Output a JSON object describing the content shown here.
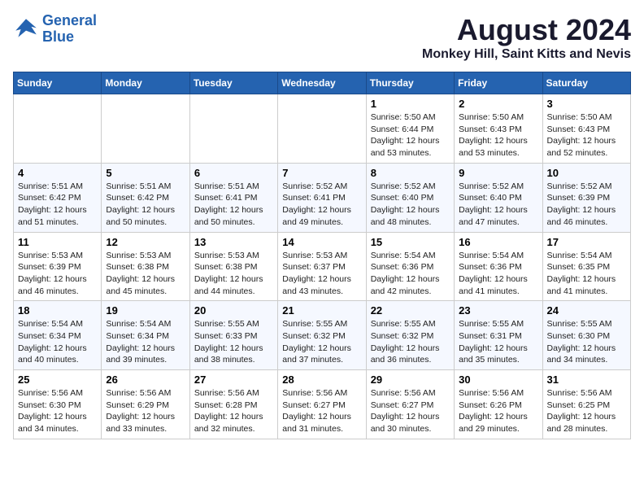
{
  "logo": {
    "line1": "General",
    "line2": "Blue"
  },
  "title": "August 2024",
  "subtitle": "Monkey Hill, Saint Kitts and Nevis",
  "days_header": [
    "Sunday",
    "Monday",
    "Tuesday",
    "Wednesday",
    "Thursday",
    "Friday",
    "Saturday"
  ],
  "weeks": [
    [
      {
        "num": "",
        "info": ""
      },
      {
        "num": "",
        "info": ""
      },
      {
        "num": "",
        "info": ""
      },
      {
        "num": "",
        "info": ""
      },
      {
        "num": "1",
        "info": "Sunrise: 5:50 AM\nSunset: 6:44 PM\nDaylight: 12 hours\nand 53 minutes."
      },
      {
        "num": "2",
        "info": "Sunrise: 5:50 AM\nSunset: 6:43 PM\nDaylight: 12 hours\nand 53 minutes."
      },
      {
        "num": "3",
        "info": "Sunrise: 5:50 AM\nSunset: 6:43 PM\nDaylight: 12 hours\nand 52 minutes."
      }
    ],
    [
      {
        "num": "4",
        "info": "Sunrise: 5:51 AM\nSunset: 6:42 PM\nDaylight: 12 hours\nand 51 minutes."
      },
      {
        "num": "5",
        "info": "Sunrise: 5:51 AM\nSunset: 6:42 PM\nDaylight: 12 hours\nand 50 minutes."
      },
      {
        "num": "6",
        "info": "Sunrise: 5:51 AM\nSunset: 6:41 PM\nDaylight: 12 hours\nand 50 minutes."
      },
      {
        "num": "7",
        "info": "Sunrise: 5:52 AM\nSunset: 6:41 PM\nDaylight: 12 hours\nand 49 minutes."
      },
      {
        "num": "8",
        "info": "Sunrise: 5:52 AM\nSunset: 6:40 PM\nDaylight: 12 hours\nand 48 minutes."
      },
      {
        "num": "9",
        "info": "Sunrise: 5:52 AM\nSunset: 6:40 PM\nDaylight: 12 hours\nand 47 minutes."
      },
      {
        "num": "10",
        "info": "Sunrise: 5:52 AM\nSunset: 6:39 PM\nDaylight: 12 hours\nand 46 minutes."
      }
    ],
    [
      {
        "num": "11",
        "info": "Sunrise: 5:53 AM\nSunset: 6:39 PM\nDaylight: 12 hours\nand 46 minutes."
      },
      {
        "num": "12",
        "info": "Sunrise: 5:53 AM\nSunset: 6:38 PM\nDaylight: 12 hours\nand 45 minutes."
      },
      {
        "num": "13",
        "info": "Sunrise: 5:53 AM\nSunset: 6:38 PM\nDaylight: 12 hours\nand 44 minutes."
      },
      {
        "num": "14",
        "info": "Sunrise: 5:53 AM\nSunset: 6:37 PM\nDaylight: 12 hours\nand 43 minutes."
      },
      {
        "num": "15",
        "info": "Sunrise: 5:54 AM\nSunset: 6:36 PM\nDaylight: 12 hours\nand 42 minutes."
      },
      {
        "num": "16",
        "info": "Sunrise: 5:54 AM\nSunset: 6:36 PM\nDaylight: 12 hours\nand 41 minutes."
      },
      {
        "num": "17",
        "info": "Sunrise: 5:54 AM\nSunset: 6:35 PM\nDaylight: 12 hours\nand 41 minutes."
      }
    ],
    [
      {
        "num": "18",
        "info": "Sunrise: 5:54 AM\nSunset: 6:34 PM\nDaylight: 12 hours\nand 40 minutes."
      },
      {
        "num": "19",
        "info": "Sunrise: 5:54 AM\nSunset: 6:34 PM\nDaylight: 12 hours\nand 39 minutes."
      },
      {
        "num": "20",
        "info": "Sunrise: 5:55 AM\nSunset: 6:33 PM\nDaylight: 12 hours\nand 38 minutes."
      },
      {
        "num": "21",
        "info": "Sunrise: 5:55 AM\nSunset: 6:32 PM\nDaylight: 12 hours\nand 37 minutes."
      },
      {
        "num": "22",
        "info": "Sunrise: 5:55 AM\nSunset: 6:32 PM\nDaylight: 12 hours\nand 36 minutes."
      },
      {
        "num": "23",
        "info": "Sunrise: 5:55 AM\nSunset: 6:31 PM\nDaylight: 12 hours\nand 35 minutes."
      },
      {
        "num": "24",
        "info": "Sunrise: 5:55 AM\nSunset: 6:30 PM\nDaylight: 12 hours\nand 34 minutes."
      }
    ],
    [
      {
        "num": "25",
        "info": "Sunrise: 5:56 AM\nSunset: 6:30 PM\nDaylight: 12 hours\nand 34 minutes."
      },
      {
        "num": "26",
        "info": "Sunrise: 5:56 AM\nSunset: 6:29 PM\nDaylight: 12 hours\nand 33 minutes."
      },
      {
        "num": "27",
        "info": "Sunrise: 5:56 AM\nSunset: 6:28 PM\nDaylight: 12 hours\nand 32 minutes."
      },
      {
        "num": "28",
        "info": "Sunrise: 5:56 AM\nSunset: 6:27 PM\nDaylight: 12 hours\nand 31 minutes."
      },
      {
        "num": "29",
        "info": "Sunrise: 5:56 AM\nSunset: 6:27 PM\nDaylight: 12 hours\nand 30 minutes."
      },
      {
        "num": "30",
        "info": "Sunrise: 5:56 AM\nSunset: 6:26 PM\nDaylight: 12 hours\nand 29 minutes."
      },
      {
        "num": "31",
        "info": "Sunrise: 5:56 AM\nSunset: 6:25 PM\nDaylight: 12 hours\nand 28 minutes."
      }
    ]
  ]
}
